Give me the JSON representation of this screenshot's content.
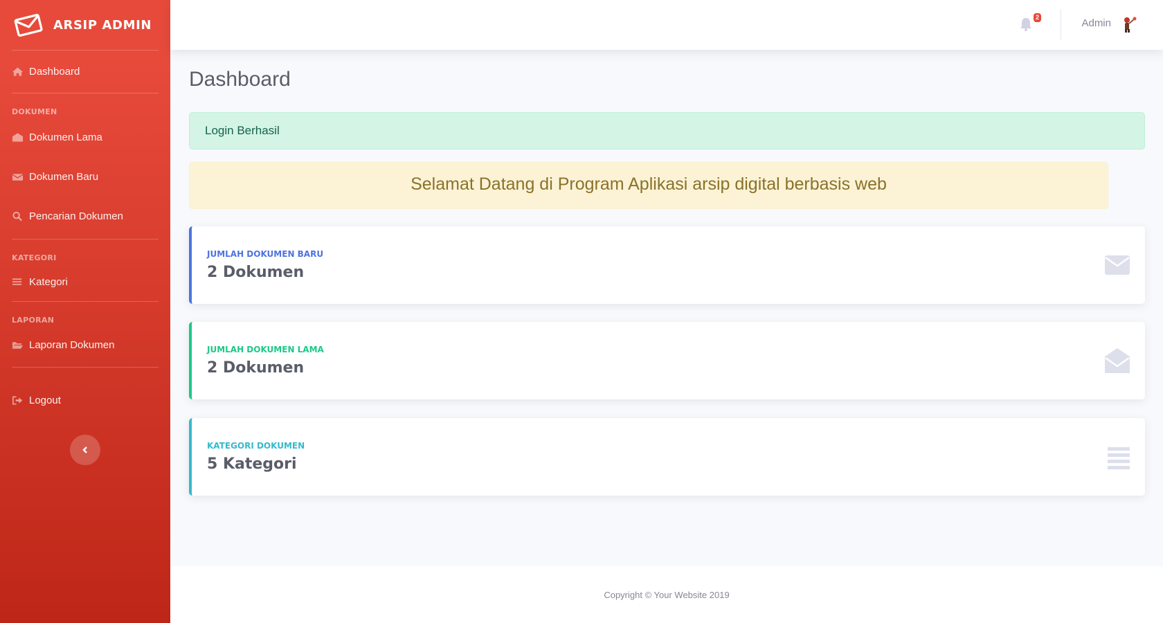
{
  "brand": {
    "name": "ARSIP ADMIN",
    "icon": "envelope-icon"
  },
  "sidebar": {
    "dashboard": {
      "label": "Dashboard",
      "icon": "home-icon"
    },
    "sections": [
      {
        "heading": "DOKUMEN"
      },
      {
        "heading": "KATEGORI"
      },
      {
        "heading": "LAPORAN"
      }
    ],
    "items": {
      "dokumen_lama": {
        "label": "Dokumen Lama",
        "icon": "envelope-open-icon"
      },
      "dokumen_baru": {
        "label": "Dokumen Baru",
        "icon": "envelope-icon"
      },
      "pencarian": {
        "label": "Pencarian Dokumen",
        "icon": "search-icon"
      },
      "kategori": {
        "label": "Kategori",
        "icon": "list-icon"
      },
      "laporan": {
        "label": "Laporan Dokumen",
        "icon": "folder-open-icon"
      },
      "logout": {
        "label": "Logout",
        "icon": "sign-out-icon"
      }
    },
    "toggle_icon": "chevron-left-icon"
  },
  "topbar": {
    "notifications_count": "2",
    "user_name": "Admin"
  },
  "main": {
    "title": "Dashboard",
    "alert_success": "Login Berhasil",
    "welcome": "Selamat Datang di Program Aplikasi arsip digital berbasis web",
    "cards": [
      {
        "label": "Jumlah Dokumen Baru",
        "value": "2 Dokumen",
        "icon": "envelope-icon",
        "color": "#4e73df"
      },
      {
        "label": "Jumlah Dokumen Lama",
        "value": "2 Dokumen",
        "icon": "envelope-open-icon",
        "color": "#1cc88a"
      },
      {
        "label": "Kategori Dokumen",
        "value": "5 Kategori",
        "icon": "list-icon",
        "color": "#36b9cc"
      }
    ]
  },
  "footer": {
    "copyright": "Copyright © Your Website 2019"
  },
  "colors": {
    "sidebar_top": "#e74a3b",
    "sidebar_bottom": "#be2617",
    "primary": "#4e73df",
    "success": "#1cc88a",
    "info": "#36b9cc"
  }
}
